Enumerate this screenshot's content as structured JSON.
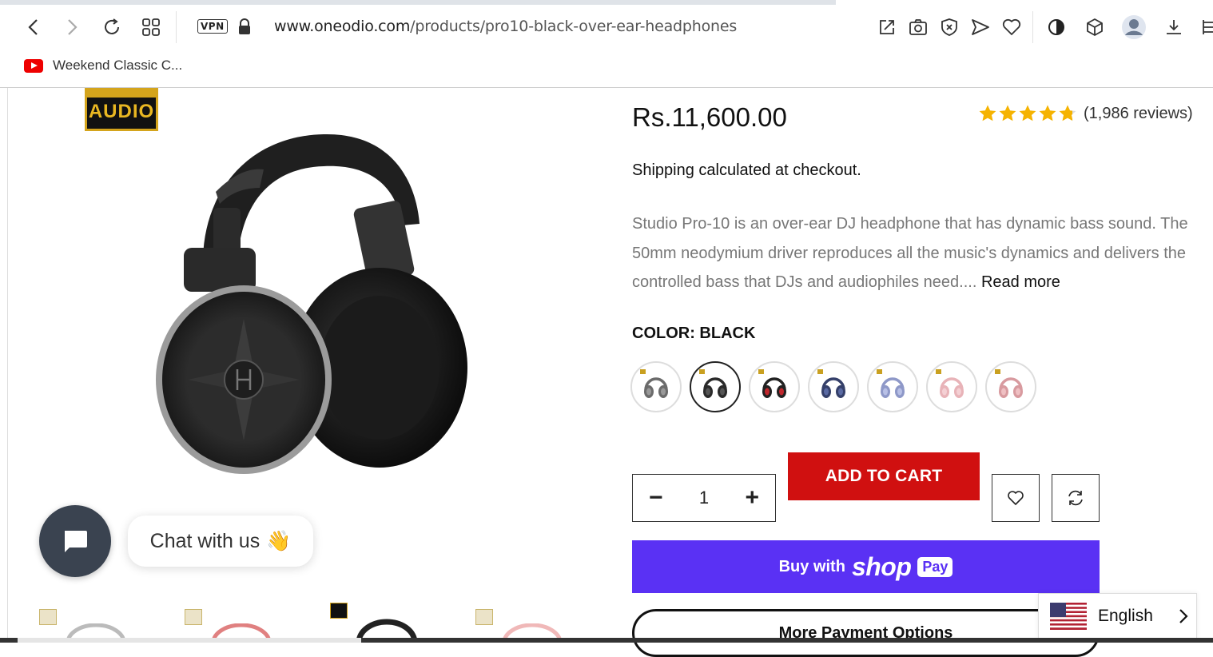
{
  "browser": {
    "url_host": "www.oneodio.com",
    "url_path": "/products/pro10-black-over-ear-headphones",
    "vpn_label": "VPN",
    "bookmark_label": "Weekend Classic C..."
  },
  "badge": {
    "text": "AUDIO"
  },
  "product": {
    "price": "Rs.11,600.00",
    "rating_value": 4.8,
    "reviews": "(1,986 reviews)",
    "shipping": "Shipping calculated at checkout.",
    "description": "Studio Pro-10 is an over-ear DJ headphone that has dynamic bass sound. The 50mm neodymium driver reproduces all the music's dynamics and delivers the controlled bass that DJs and audiophiles need....",
    "read_more": "Read more",
    "color_label": "COLOR: BLACK",
    "swatches": [
      {
        "name": "Grey",
        "color": "#6b6b6b",
        "accent": "#999"
      },
      {
        "name": "Black",
        "color": "#2a2a2a",
        "accent": "#555"
      },
      {
        "name": "Red Black",
        "color": "#222",
        "accent": "#c0272d"
      },
      {
        "name": "Blue",
        "color": "#35406a",
        "accent": "#5a6aa3"
      },
      {
        "name": "Lavender",
        "color": "#8e98c8",
        "accent": "#b8c0e6"
      },
      {
        "name": "Pink",
        "color": "#e8b3b8",
        "accent": "#f4d0d4"
      },
      {
        "name": "Rose Gold",
        "color": "#d89a9f",
        "accent": "#efc0c3"
      }
    ],
    "quantity": "1",
    "qty_minus": "−",
    "qty_plus": "+",
    "add_to_cart": "ADD TO CART",
    "buy_with": "Buy with",
    "shop": "shop",
    "pay": "Pay",
    "more_payment": "More Payment Options"
  },
  "chat": {
    "label": "Chat with us",
    "emoji": "👋"
  },
  "language": {
    "label": "English"
  },
  "colors": {
    "accent_red": "#d01010",
    "shop_pay": "#5a31f4",
    "chat_bg": "#3a4350",
    "star": "#f5b301"
  }
}
